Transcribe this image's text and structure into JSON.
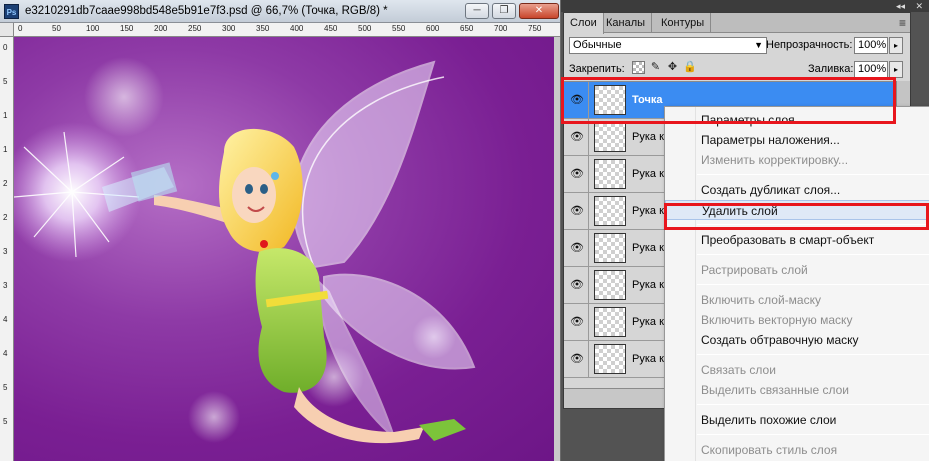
{
  "document": {
    "title": "e3210291db7caae998bd548e5b91e7f3.psd @ 66,7% (Точка, RGB/8) *",
    "ps_icon_label": "Ps",
    "minimize_glyph": "─",
    "restore_glyph": "❐",
    "close_glyph": "✕",
    "ruler_h_ticks": [
      "0",
      "50",
      "100",
      "150",
      "200",
      "250",
      "300",
      "350",
      "400",
      "450",
      "500",
      "550",
      "600",
      "650",
      "700",
      "750"
    ],
    "ruler_v_ticks": [
      "0",
      "5",
      "1",
      "1",
      "2",
      "2",
      "3",
      "3",
      "4",
      "4",
      "5",
      "5"
    ]
  },
  "layers_panel": {
    "tabs": [
      "Слои",
      "Каналы",
      "Контуры"
    ],
    "active_tab": 0,
    "blend_mode": "Обычные",
    "opacity_label": "Непрозрачность:",
    "opacity_value": "100%",
    "lock_label": "Закрепить:",
    "fill_label": "Заливка:",
    "fill_value": "100%",
    "layers": [
      {
        "name": "Точка",
        "selected": true
      },
      {
        "name": "Рука к",
        "selected": false
      },
      {
        "name": "Рука к",
        "selected": false
      },
      {
        "name": "Рука к",
        "selected": false
      },
      {
        "name": "Рука к",
        "selected": false
      },
      {
        "name": "Рука к",
        "selected": false
      },
      {
        "name": "Рука к",
        "selected": false
      },
      {
        "name": "Рука к",
        "selected": false
      }
    ]
  },
  "context_menu": {
    "items": [
      {
        "label": "Параметры слоя...",
        "disabled": false
      },
      {
        "label": "Параметры наложения...",
        "disabled": false
      },
      {
        "label": "Изменить корректировку...",
        "disabled": true
      },
      {
        "sep": true
      },
      {
        "label": "Создать дубликат слоя...",
        "disabled": false
      },
      {
        "label": "Удалить слой",
        "disabled": false,
        "hover": true
      },
      {
        "sep": true
      },
      {
        "label": "Преобразовать в смарт-объект",
        "disabled": false
      },
      {
        "sep": true
      },
      {
        "label": "Растрировать слой",
        "disabled": true
      },
      {
        "sep": true
      },
      {
        "label": "Включить слой-маску",
        "disabled": true
      },
      {
        "label": "Включить векторную маску",
        "disabled": true
      },
      {
        "label": "Создать обтравочную маску",
        "disabled": false
      },
      {
        "sep": true
      },
      {
        "label": "Связать слои",
        "disabled": true
      },
      {
        "label": "Выделить связанные слои",
        "disabled": true
      },
      {
        "sep": true
      },
      {
        "label": "Выделить похожие слои",
        "disabled": false
      },
      {
        "sep": true
      },
      {
        "label": "Скопировать стиль слоя",
        "disabled": true
      }
    ]
  },
  "colors": {
    "selection_blue": "#3b8cf2",
    "highlight_red": "#e8161d",
    "canvas_purple": "#7a1f93"
  }
}
